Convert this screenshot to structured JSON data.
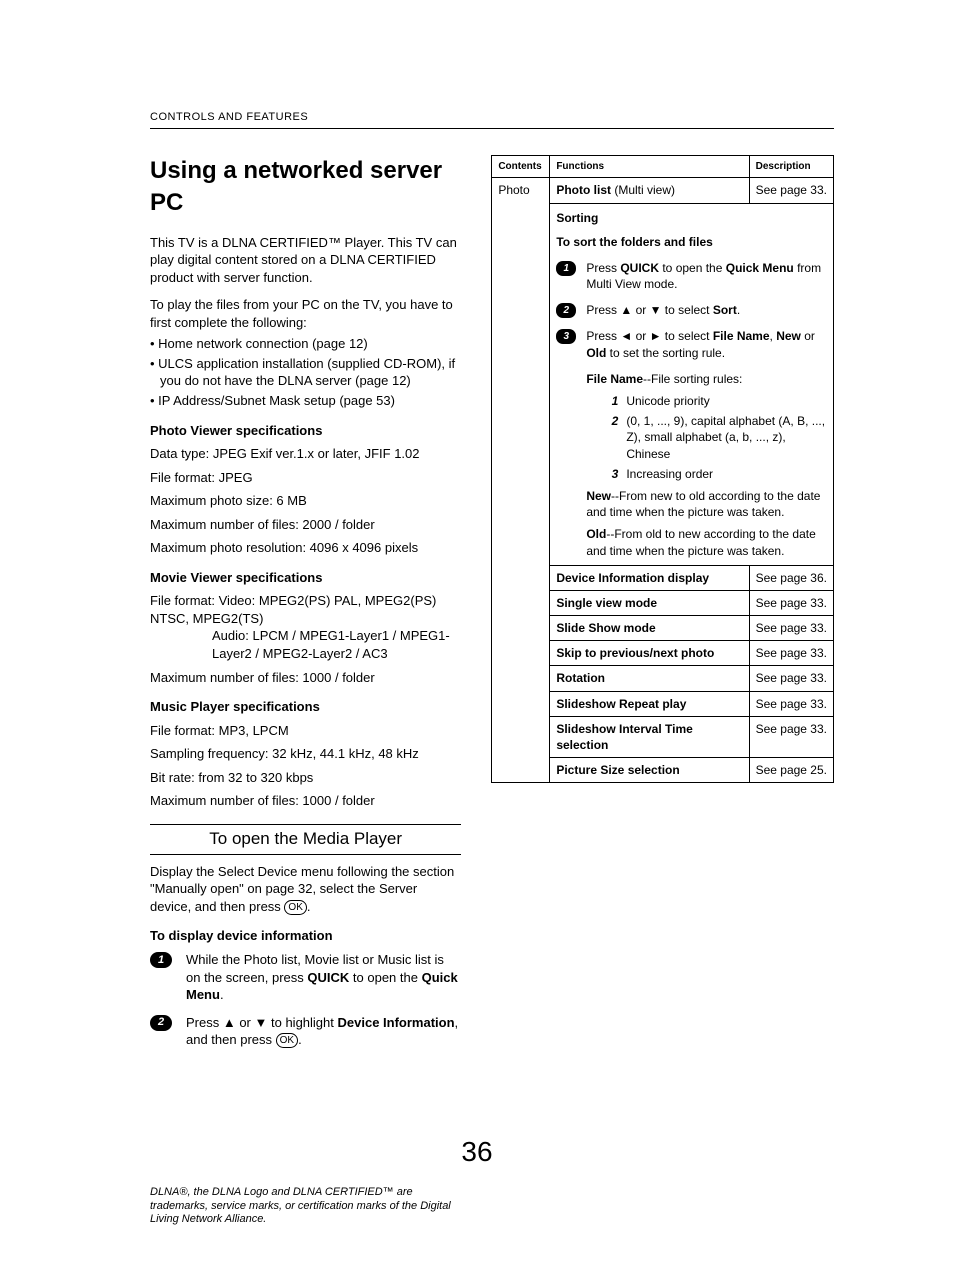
{
  "header": {
    "section": "CONTROLS AND FEATURES"
  },
  "title": "Using a networked server PC",
  "intro1": "This TV is a DLNA CERTIFIED™ Player. This TV can play digital content stored on a DLNA CERTIFIED product with server function.",
  "intro2": "To play the files from your PC on the TV, you have to first complete the following:",
  "bullets": {
    "b1": "Home network connection (page 12)",
    "b2": "ULCS application installation (supplied CD-ROM), if you do not have the DLNA server (page 12)",
    "b3": "IP Address/Subnet Mask setup (page 53)"
  },
  "photo": {
    "heading": "Photo Viewer specifications",
    "l1": "Data type: JPEG Exif ver.1.x or later, JFIF 1.02",
    "l2": "File format: JPEG",
    "l3": "Maximum photo size: 6 MB",
    "l4": "Maximum number of files: 2000 / folder",
    "l5": "Maximum photo resolution: 4096 x 4096 pixels"
  },
  "movie": {
    "heading": "Movie Viewer specifications",
    "video_label": "File format: Video:",
    "video": "MPEG2(PS) PAL, MPEG2(PS) NTSC, MPEG2(TS)",
    "audio_label": "Audio:",
    "audio": "LPCM / MPEG1-Layer1 / MPEG1-Layer2 / MPEG2-Layer2 / AC3",
    "files": "Maximum number of files: 1000 / folder"
  },
  "music": {
    "heading": "Music Player specifications",
    "l1": "File format: MP3, LPCM",
    "l2": "Sampling frequency: 32 kHz, 44.1 kHz, 48 kHz",
    "l3": "Bit rate: from 32 to 320 kbps",
    "l4": "Maximum number of files: 1000 / folder"
  },
  "open": {
    "title": "To open the Media Player",
    "intro_a": "Display the Select Device menu following the section \"Manually open\" on page 32, select the Server device, and then press ",
    "intro_b": ".",
    "devinfo": "To display device information",
    "step1_a": "While the Photo list, Movie list or Music list is on the screen, press ",
    "step1_quick": "QUICK",
    "step1_b": " to open the ",
    "step1_qm": "Quick Menu",
    "step1_c": ".",
    "step2_a": "Press ",
    "step2_b": " or ",
    "step2_c": " to highlight ",
    "step2_di": "Device Information",
    "step2_d": ", and then press ",
    "step2_e": "."
  },
  "table": {
    "h1": "Contents",
    "h2": "Functions",
    "h3": "Description",
    "content_photo": "Photo",
    "r1_func_a": "Photo list",
    "r1_func_b": " (Multi view)",
    "r1_desc": "See page 33.",
    "sorting": "Sorting",
    "sort_title": "To sort the folders and files",
    "s1_a": "Press ",
    "s1_quick": "QUICK",
    "s1_b": " to open the ",
    "s1_qm": "Quick Menu",
    "s1_c": " from Multi View mode.",
    "s2_a": "Press ",
    "s2_b": " or ",
    "s2_c": " to select ",
    "s2_sort": "Sort",
    "s2_d": ".",
    "s3_a": "Press ",
    "s3_b": " or ",
    "s3_c": " to select ",
    "s3_fn": "File Name",
    "s3_d": ", ",
    "s3_new": "New",
    "s3_e": " or ",
    "s3_old": "Old",
    "s3_f": " to set the sorting rule.",
    "fn_rules_label": "File Name",
    "fn_rules_suffix": "--File sorting rules:",
    "rule1": "Unicode priority",
    "rule2": "(0, 1, ..., 9), capital alphabet (A, B, ..., Z), small alphabet (a, b, ..., z), Chinese",
    "rule3": "Increasing order",
    "new_label": "New",
    "new_text": "--From new to old according to the date and time when the picture was taken.",
    "old_label": "Old",
    "old_text": "--From old to new according to the date and time when the picture was taken.",
    "r3_func": "Device Information display",
    "r3_desc": "See page 36.",
    "r4_func": "Single view mode",
    "r4_desc": "See page 33.",
    "r5_func": "Slide Show mode",
    "r5_desc": "See page 33.",
    "r6_func": "Skip to previous/next photo",
    "r6_desc": "See page 33.",
    "r7_func": "Rotation",
    "r7_desc": "See page 33.",
    "r8_func": "Slideshow Repeat play",
    "r8_desc": "See page 33.",
    "r9_func": "Slideshow Interval Time selection",
    "r9_desc": "See page 33.",
    "r10_func": "Picture Size selection",
    "r10_desc": "See page 25."
  },
  "footnote": "DLNA®, the DLNA Logo and DLNA CERTIFIED™ are trademarks, service marks, or certification marks of the Digital Living Network Alliance.",
  "page_number": "36",
  "ok_label": "OK"
}
